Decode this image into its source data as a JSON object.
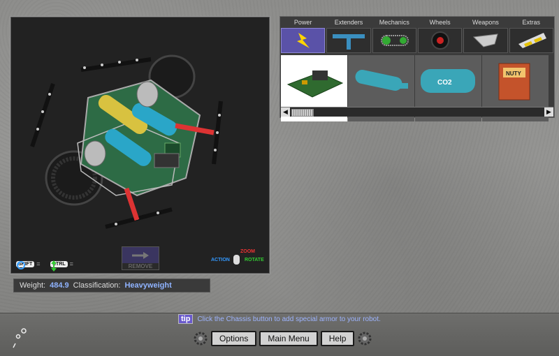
{
  "viewport": {
    "shift_key": "SHIFT",
    "ctrl_key": "CTRL",
    "remove_label": "REMOVE",
    "mouse_legend": {
      "zoom": "ZOOM",
      "action": "ACTION",
      "rotate": "ROTATE"
    }
  },
  "stats": {
    "weight_label": "Weight:",
    "weight_value": "484.9",
    "class_label": "Classification:",
    "class_value": "Heavyweight"
  },
  "parts": {
    "tabs": [
      {
        "label": "Power",
        "icon": "lightning-icon",
        "active": true
      },
      {
        "label": "Extenders",
        "icon": "extender-bar-icon"
      },
      {
        "label": "Mechanics",
        "icon": "chain-gear-icon"
      },
      {
        "label": "Wheels",
        "icon": "wheel-icon"
      },
      {
        "label": "Weapons",
        "icon": "blade-icon"
      },
      {
        "label": "Extras",
        "icon": "hazard-plate-icon"
      }
    ],
    "items": [
      {
        "name": "circuit-board",
        "selected": true
      },
      {
        "name": "cylinder-tank"
      },
      {
        "name": "co2-canister",
        "text": "CO2"
      },
      {
        "name": "battery",
        "text": "NUTY"
      }
    ]
  },
  "tip": {
    "badge": "tip",
    "text": "Click the Chassis button to add special armor to your robot."
  },
  "menu": {
    "options": "Options",
    "main_menu": "Main Menu",
    "help": "Help"
  },
  "colors": {
    "accent": "#5a52a8",
    "stat_value": "#8fb3ff",
    "tip_text": "#9db4ff"
  }
}
